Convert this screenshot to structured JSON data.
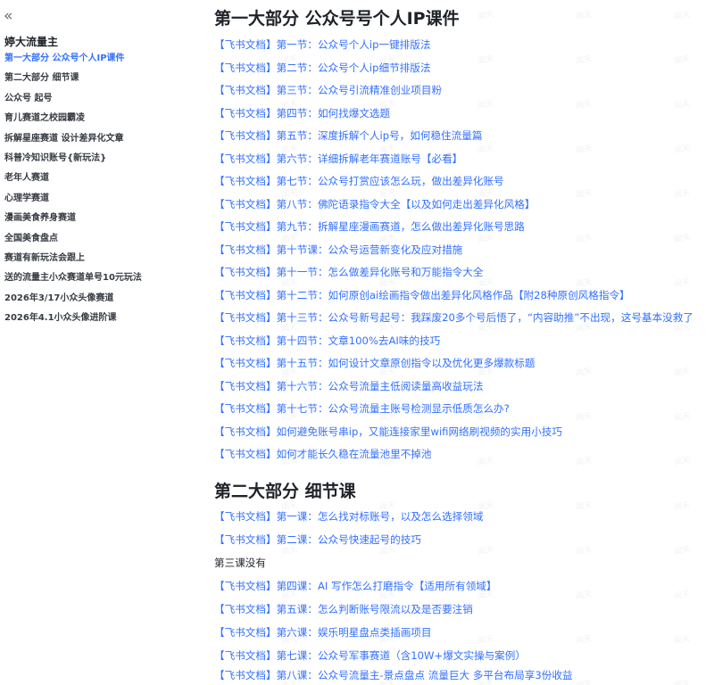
{
  "sidebar": {
    "title": "婷大流量主",
    "items": [
      {
        "label": "第一大部分 公众号个人IP课件",
        "active": true
      },
      {
        "label": "第二大部分 细节课"
      },
      {
        "label": "公众号 起号"
      },
      {
        "label": "育儿赛道之校园霸凌"
      },
      {
        "label": "拆解星座赛道 设计差异化文章"
      },
      {
        "label": "科普冷知识账号{新玩法}"
      },
      {
        "label": "老年人赛道"
      },
      {
        "label": "心理学赛道"
      },
      {
        "label": "漫画美食养身赛道"
      },
      {
        "label": "全国美食盘点"
      },
      {
        "label": "赛道有新玩法会跟上"
      },
      {
        "label": "送的流量主小众赛道单号10元玩法"
      },
      {
        "label": "2026年3/17小众头像赛道"
      },
      {
        "label": "2026年4.1小众头像进阶课"
      }
    ]
  },
  "watermark_text": "闻天",
  "main": {
    "section1": {
      "title": "第一大部分 公众号号个人IP课件",
      "links": [
        "【飞书文档】第一节：公众号个人ip一键排版法",
        "【飞书文档】第二节：公众号个人ip细节排版法",
        "【飞书文档】第三节：公众号引流精准创业项目粉",
        "【飞书文档】第四节：如何找爆文选题",
        "【飞书文档】第五节：深度拆解个人ip号，如何稳住流量篇",
        "【飞书文档】第六节：详细拆解老年赛道账号【必看】",
        "【飞书文档】第七节：公众号打赏应该怎么玩，做出差异化账号",
        "【飞书文档】第八节：佛陀语录指令大全【以及如何走出差异化风格】",
        "【飞书文档】第九节：拆解星座漫画赛道，怎么做出差异化账号思路",
        "【飞书文档】第十节课：公众号运营新变化及应对措施",
        "【飞书文档】第十一节：怎么做差异化账号和万能指令大全",
        "【飞书文档】第十二节：如何原创ai绘画指令做出差异化风格作品【附28种原创风格指令】",
        "【飞书文档】第十三节：公众号新号起号：我踩废20多个号后悟了，“内容助推”不出现，这号基本没救了",
        "【飞书文档】第十四节：文章100%去AI味的技巧",
        "【飞书文档】第十五节：如何设计文章原创指令以及优化更多爆款标题",
        "【飞书文档】第十六节：公众号流量主低阅读量高收益玩法",
        "【飞书文档】第十七节：公众号流量主账号检测显示低质怎么办?",
        "【飞书文档】如何避免账号串ip，又能连接家里wifi网络刷视频的实用小技巧",
        "【飞书文档】如何才能长久稳在流量池里不掉池"
      ]
    },
    "section2": {
      "title": "第二大部分 细节课",
      "lines": [
        {
          "text": "【飞书文档】第一课：怎么找对标账号，以及怎么选择领域",
          "link": true
        },
        {
          "text": "【飞书文档】第二课：公众号快速起号的技巧",
          "link": true
        },
        {
          "text": "第三课没有",
          "link": false
        },
        {
          "text": "【飞书文档】第四课：AI 写作怎么打磨指令【适用所有领域】",
          "link": true
        },
        {
          "text": "【飞书文档】第五课：怎么判断账号限流以及是否要注销",
          "link": true
        },
        {
          "text": "【飞书文档】第六课：娱乐明星盘点类插画项目",
          "link": true
        },
        {
          "text": "【飞书文档】第七课：公众号军事赛道（含10W+爆文实操与案例）",
          "link": true
        },
        {
          "text": "【飞书文档】第八课：公众号流量主-景点盘点 流量巨大 多平台布局享3份收益",
          "link": true
        }
      ]
    }
  }
}
